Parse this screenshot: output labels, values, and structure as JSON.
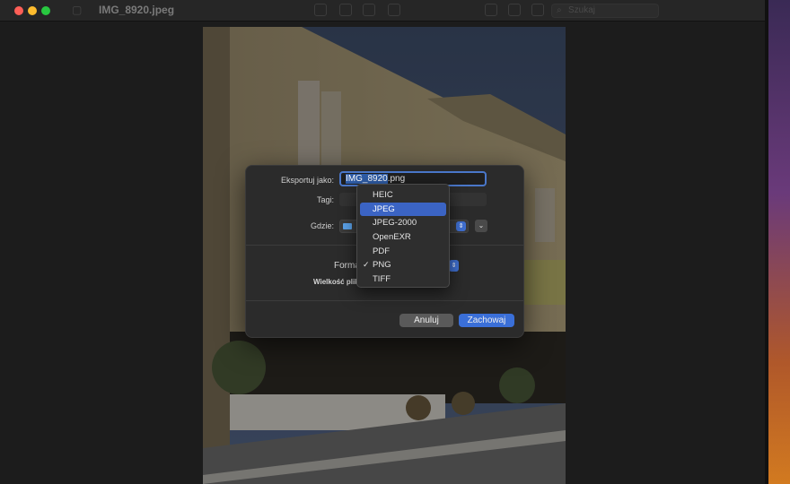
{
  "window": {
    "title": "IMG_8920.jpeg",
    "search_placeholder": "Szukaj"
  },
  "dialog": {
    "export_as_label": "Eksportuj jako:",
    "filename_selected": "IMG_8920",
    "filename_ext": ".png",
    "tags_label": "Tagi:",
    "where_label": "Gdzie:",
    "format_label": "Format",
    "file_size_label": "Wielkość pliku",
    "cancel_label": "Anuluj",
    "save_label": "Zachowaj"
  },
  "format_menu": {
    "items": [
      "HEIC",
      "JPEG",
      "JPEG-2000",
      "OpenEXR",
      "PDF",
      "PNG",
      "TIFF"
    ],
    "highlighted": "JPEG",
    "checked": "PNG",
    "check_glyph": "✓"
  },
  "colors": {
    "accent": "#3b64c4",
    "close": "#ff5f57",
    "minimize": "#febc2e",
    "zoom": "#28c840"
  }
}
